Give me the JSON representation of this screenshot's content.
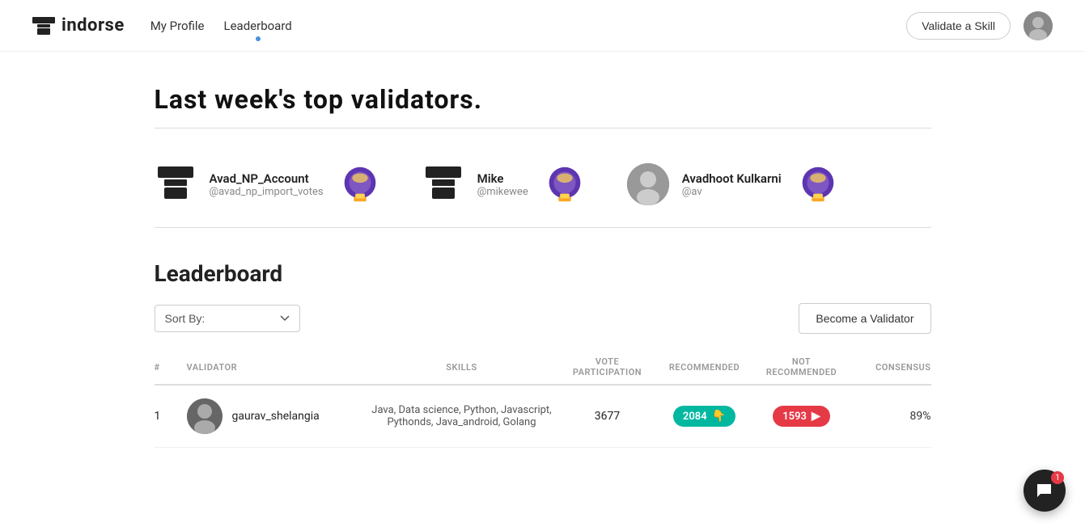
{
  "nav": {
    "logo_text": "indorse",
    "links": [
      {
        "label": "My Profile",
        "active": false
      },
      {
        "label": "Leaderboard",
        "active": true
      }
    ],
    "validate_btn": "Validate a Skill"
  },
  "top_validators": {
    "section_title": "Last week's top validators.",
    "validators": [
      {
        "name": "Avad_NP_Account",
        "handle": "@avad_np_import_votes",
        "type": "icon"
      },
      {
        "name": "Mike",
        "handle": "@mikewee",
        "type": "icon"
      },
      {
        "name": "Avadhoot Kulkarni",
        "handle": "@av",
        "type": "photo"
      }
    ]
  },
  "leaderboard": {
    "title": "Leaderboard",
    "sort_label": "Sort By:",
    "sort_placeholder": "Sort By:",
    "become_validator_btn": "Become a Validator",
    "table": {
      "headers": [
        "#",
        "VALIDATOR",
        "SKILLS",
        "VOTE PARTICIPATION",
        "RECOMMENDED",
        "NOT RECOMMENDED",
        "CONSENSUS"
      ],
      "rows": [
        {
          "rank": "1",
          "name": "gaurav_shelangia",
          "skills": "Java, Data science, Python, Javascript, Pythonds, Java_android, Golang",
          "vote_participation": "3677",
          "recommended": "2084",
          "not_recommended": "1593",
          "consensus": "89%"
        }
      ]
    }
  },
  "chat": {
    "badge_count": "1"
  }
}
